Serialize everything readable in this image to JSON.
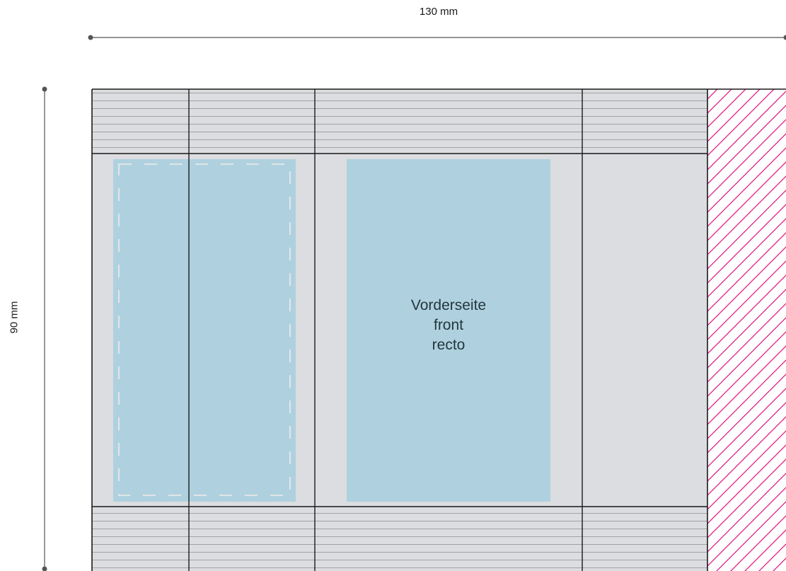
{
  "dimensions": {
    "width_label": "130 mm",
    "height_label": "90 mm"
  },
  "front_panel": {
    "line1": "Vorderseite",
    "line2": "front",
    "line3": "recto"
  },
  "colors": {
    "background": "#ffffff",
    "panel_gray": "#dcdde0",
    "print_area_blue": "#afd1df",
    "hatch_magenta": "#e0127f",
    "fold_line": "#1a1a1a",
    "dimension_line": "#555555",
    "stripe_line": "#9b9b9b",
    "cut_dash": "#e8e8e8"
  }
}
